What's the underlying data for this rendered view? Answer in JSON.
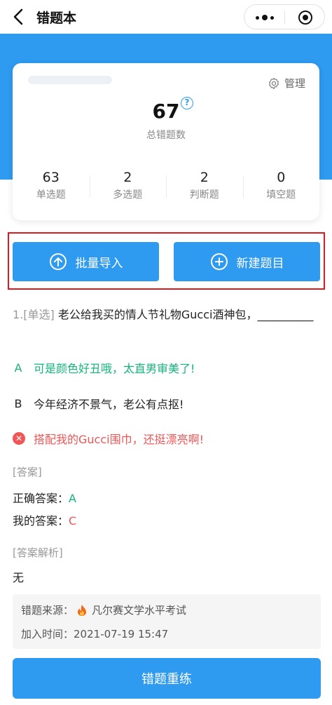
{
  "nav": {
    "title": "错题本"
  },
  "stats": {
    "manage_label": "管理",
    "total": "67",
    "total_label": "总错题数",
    "items": [
      {
        "count": "63",
        "label": "单选题"
      },
      {
        "count": "2",
        "label": "多选题"
      },
      {
        "count": "2",
        "label": "判断题"
      },
      {
        "count": "0",
        "label": "填空题"
      }
    ]
  },
  "actions": {
    "import_label": "批量导入",
    "new_label": "新建题目"
  },
  "question": {
    "number": "1.[单选]",
    "text": "老公给我买的情人节礼物Gucci酒神包，__________",
    "options": [
      {
        "letter": "A",
        "text": "可是颜色好丑哦，太直男审美了!"
      },
      {
        "letter": "B",
        "text": "今年经济不景气，老公有点抠!"
      },
      {
        "letter": "",
        "text": "搭配我的Gucci围巾，还挺漂亮啊!"
      }
    ]
  },
  "answer": {
    "section_label": "[答案]",
    "correct_label": "正确答案：",
    "correct_value": "A",
    "mine_label": "我的答案：",
    "mine_value": "C"
  },
  "analysis": {
    "section_label": "[答案解析]",
    "text": "无"
  },
  "source": {
    "source_label": "错题来源：",
    "source_value": "凡尔赛文学水平考试",
    "time_label": "加入时间：",
    "time_value": "2021-07-19 15:47"
  },
  "bottom": {
    "retrain_label": "错题重练"
  },
  "colors": {
    "primary": "#2e9af0",
    "correct": "#13b57a",
    "wrong": "#f05656",
    "highlight_border": "#e0191e"
  }
}
